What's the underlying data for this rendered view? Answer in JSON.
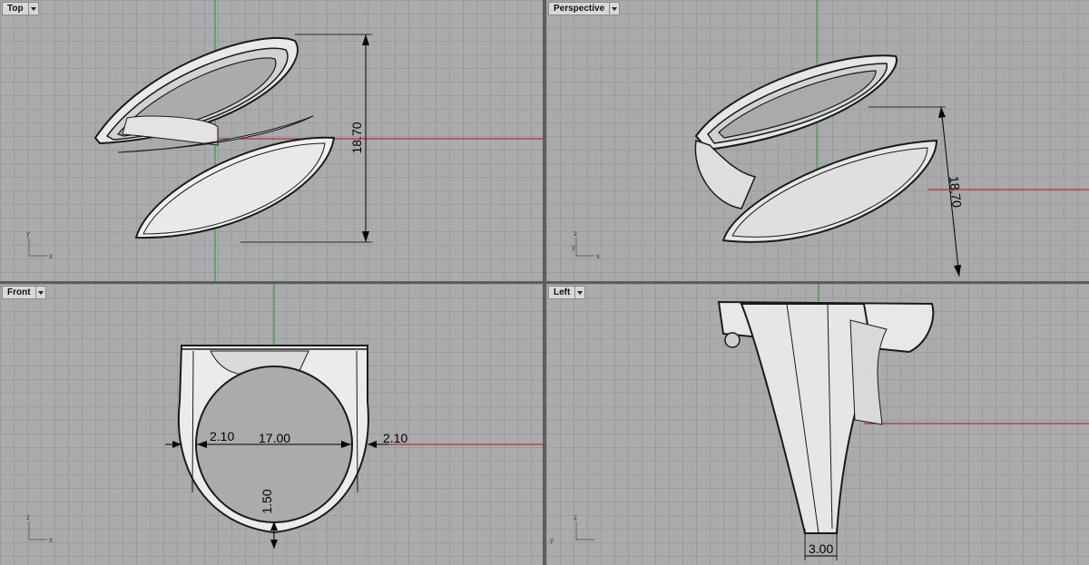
{
  "viewports": [
    {
      "id": "top",
      "name": "Top",
      "axes": [
        "y",
        "x"
      ],
      "dims": [
        "18.70"
      ]
    },
    {
      "id": "perspective",
      "name": "Perspective",
      "axes": [
        "z",
        "y",
        "x"
      ],
      "dims": [
        "18.70"
      ]
    },
    {
      "id": "front",
      "name": "Front",
      "axes": [
        "z",
        "x"
      ],
      "dims": [
        "2.10",
        "17.00",
        "2.10",
        "1.50"
      ]
    },
    {
      "id": "left",
      "name": "Left",
      "axes": [
        "z",
        "y"
      ],
      "dims": [
        "3.00"
      ]
    }
  ],
  "colors": {
    "x_axis": "#c41010",
    "y_axis": "#19a319",
    "grid": "#9a9c9e",
    "background": "#a9abad",
    "surface": "#ececec"
  }
}
